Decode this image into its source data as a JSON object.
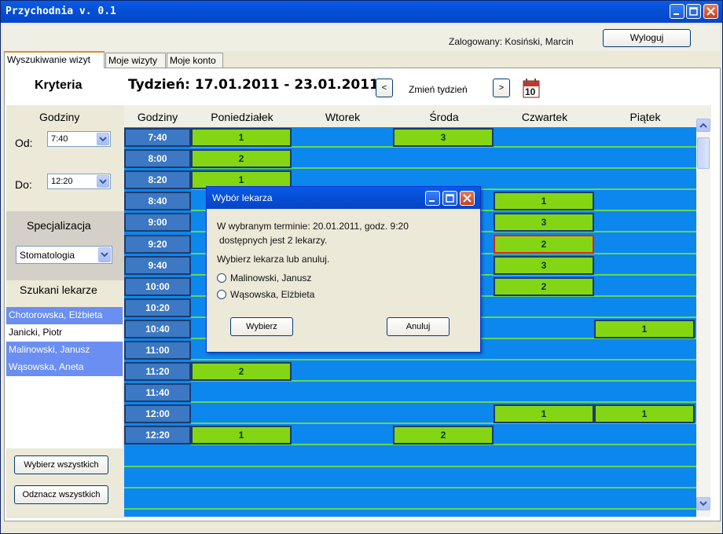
{
  "window": {
    "title": "Przychodnia v. 0.1"
  },
  "header": {
    "logged_in": "Zalogowany: Kosiński, Marcin",
    "logout": "Wyloguj"
  },
  "tabs": [
    {
      "label": "Wyszukiwanie wizyt"
    },
    {
      "label": "Moje wizyty"
    },
    {
      "label": "Moje konto"
    }
  ],
  "criteria": {
    "title": "Kryteria",
    "hours_title": "Godziny",
    "from_label": "Od:",
    "from_value": "7:40",
    "to_label": "Do:",
    "to_value": "12:20",
    "spec_title": "Specjalizacja",
    "spec_value": "Stomatologia",
    "doctors_title": "Szukani lekarze",
    "doctors": [
      {
        "name": "Chotorowska, Elżbieta",
        "selected": true
      },
      {
        "name": "Janicki, Piotr",
        "selected": false
      },
      {
        "name": "Malinowski, Janusz",
        "selected": true
      },
      {
        "name": "Wąsowska, Aneta",
        "selected": true
      }
    ],
    "select_all": "Wybierz wszystkich",
    "deselect_all": "Odznacz wszystkich"
  },
  "week": {
    "label": "Tydzień: 17.01.2011 - 23.01.2011",
    "prev": "<",
    "next": ">",
    "change": "Zmień tydzień",
    "calendar_day": "10"
  },
  "schedule": {
    "columns": [
      "Godziny",
      "Poniedziałek",
      "Wtorek",
      "Środa",
      "Czwartek",
      "Piątek"
    ],
    "hours": [
      "7:40",
      "8:00",
      "8:20",
      "8:40",
      "9:00",
      "9:20",
      "9:40",
      "10:00",
      "10:20",
      "10:40",
      "11:00",
      "11:20",
      "11:40",
      "12:00",
      "12:20"
    ],
    "slots": [
      {
        "hour": "7:40",
        "day": "Poniedziałek",
        "count": "1"
      },
      {
        "hour": "7:40",
        "day": "Środa",
        "count": "3"
      },
      {
        "hour": "8:00",
        "day": "Poniedziałek",
        "count": "2"
      },
      {
        "hour": "8:20",
        "day": "Poniedziałek",
        "count": "1"
      },
      {
        "hour": "8:40",
        "day": "Czwartek",
        "count": "1"
      },
      {
        "hour": "9:00",
        "day": "Czwartek",
        "count": "3"
      },
      {
        "hour": "9:20",
        "day": "Czwartek",
        "count": "2"
      },
      {
        "hour": "9:40",
        "day": "Czwartek",
        "count": "3"
      },
      {
        "hour": "10:00",
        "day": "Czwartek",
        "count": "2"
      },
      {
        "hour": "10:40",
        "day": "Piątek",
        "count": "1"
      },
      {
        "hour": "11:20",
        "day": "Poniedziałek",
        "count": "2"
      },
      {
        "hour": "12:00",
        "day": "Czwartek",
        "count": "1"
      },
      {
        "hour": "12:00",
        "day": "Piątek",
        "count": "1"
      },
      {
        "hour": "12:20",
        "day": "Poniedziałek",
        "count": "1"
      },
      {
        "hour": "12:20",
        "day": "Środa",
        "count": "2"
      }
    ]
  },
  "dialog": {
    "title": "Wybór lekarza",
    "line1": "W wybranym terminie: 20.01.2011, godz. 9:20",
    "line2": "dostępnych jest 2 lekarzy.",
    "line3": "Wybierz lekarza lub anuluj.",
    "options": [
      "Malinowski, Janusz",
      "Wąsowska, Elżbieta"
    ],
    "ok": "Wybierz",
    "cancel": "Anuluj"
  },
  "colors": {
    "grid_blue": "#0c87ee",
    "slot_green": "#84d614",
    "hour_cell": "#3c78c3",
    "selected_row": "#6a8ef1"
  }
}
